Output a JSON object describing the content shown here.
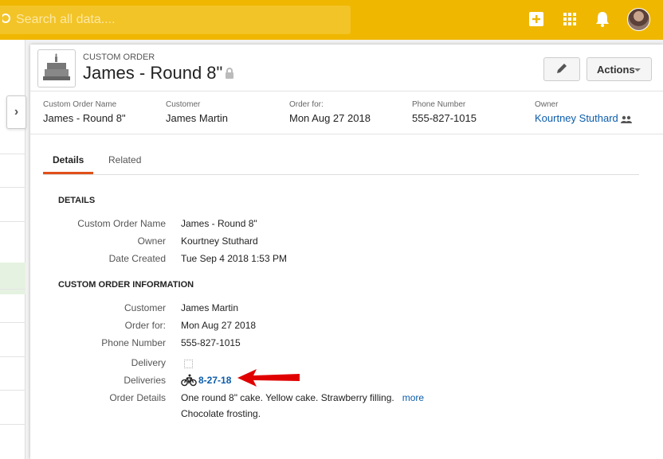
{
  "topbar": {
    "search_placeholder": "Search all data....",
    "icons": [
      "plus-square-icon",
      "app-grid-icon",
      "bell-icon",
      "user-avatar"
    ],
    "color": "#efb700"
  },
  "record": {
    "type_label": "CUSTOM ORDER",
    "title": "James - Round 8\"",
    "edit_icon": "pencil-icon",
    "actions_label": "Actions"
  },
  "highlights": [
    {
      "label": "Custom Order Name",
      "value": "James - Round 8\""
    },
    {
      "label": "Customer",
      "value": "James Martin"
    },
    {
      "label": "Order for:",
      "value": "Mon Aug 27 2018"
    },
    {
      "label": "Phone Number",
      "value": "555-827-1015"
    },
    {
      "label": "Owner",
      "value": "Kourtney Stuthard"
    }
  ],
  "tabs": [
    {
      "label": "Details",
      "active": true
    },
    {
      "label": "Related",
      "active": false
    }
  ],
  "details": {
    "section_title": "DETAILS",
    "fields": [
      {
        "label": "Custom Order Name",
        "value": "James - Round 8\""
      },
      {
        "label": "Owner",
        "value": "Kourtney Stuthard"
      },
      {
        "label": "Date Created",
        "value": "Tue Sep 4 2018 1:53 PM"
      }
    ]
  },
  "info": {
    "section_title": "CUSTOM ORDER INFORMATION",
    "fields": [
      {
        "label": "Customer",
        "value": "James Martin"
      },
      {
        "label": "Order for:",
        "value": "Mon Aug 27 2018"
      },
      {
        "label": "Phone Number",
        "value": "555-827-1015"
      }
    ],
    "delivery_label": "Delivery",
    "delivery_checked": false,
    "deliveries_label": "Deliveries",
    "deliveries_link": "8-27-18",
    "order_details_label": "Order Details",
    "order_details_line1": "One round 8\" cake. Yellow cake. Strawberry filling.",
    "order_details_line2": "Chocolate frosting.",
    "more_label": "more"
  },
  "colors": {
    "accent_tab": "#e04f1a",
    "link": "#0b5cab",
    "arrow": "#e00000"
  }
}
